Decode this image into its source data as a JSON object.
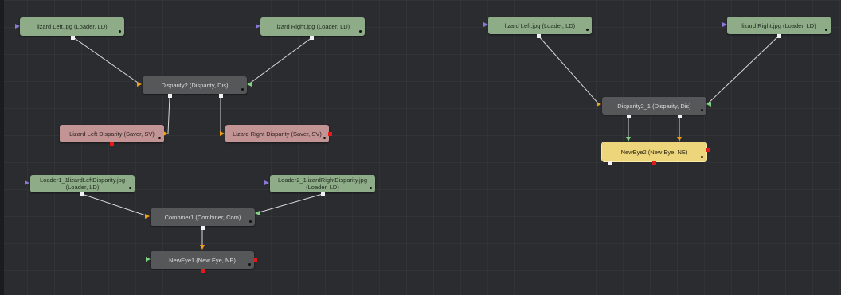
{
  "flow": {
    "nodes": {
      "tl_loader_left": {
        "line1": "lizard Left.jpg  (Loader, LD)",
        "line2": ""
      },
      "tl_loader_right": {
        "line1": "lizard Right.jpg  (Loader, LD)",
        "line2": ""
      },
      "tl_disparity": {
        "line1": "Disparity2  (Disparity, Dis)",
        "line2": ""
      },
      "tl_saver_left": {
        "line1": "Lizard Left Disparity  (Saver, SV)",
        "line2": ""
      },
      "tl_saver_right": {
        "line1": "Lizard Right Disparity  (Saver, SV)",
        "line2": ""
      },
      "tr_loader_left": {
        "line1": "lizard Left.jpg  (Loader, LD)",
        "line2": ""
      },
      "tr_loader_right": {
        "line1": "lizard Right.jpg  (Loader, LD)",
        "line2": ""
      },
      "tr_disparity": {
        "line1": "Disparity2_1  (Disparity, Dis)",
        "line2": ""
      },
      "tr_neweye": {
        "line1": "NewEye2  (New Eye, NE)",
        "line2": ""
      },
      "bl_loader1": {
        "line1": "Loader1_1lizardLeftDisparity.jpg",
        "line2": "(Loader, LD)"
      },
      "bl_loader2": {
        "line1": "Loader2_1lizardRightDisparity.jpg",
        "line2": "(Loader, LD)"
      },
      "bl_combiner": {
        "line1": "Combiner1  (Combiner, Com)",
        "line2": ""
      },
      "bl_neweye": {
        "line1": "NewEye1  (New Eye, NE)",
        "line2": ""
      }
    }
  }
}
